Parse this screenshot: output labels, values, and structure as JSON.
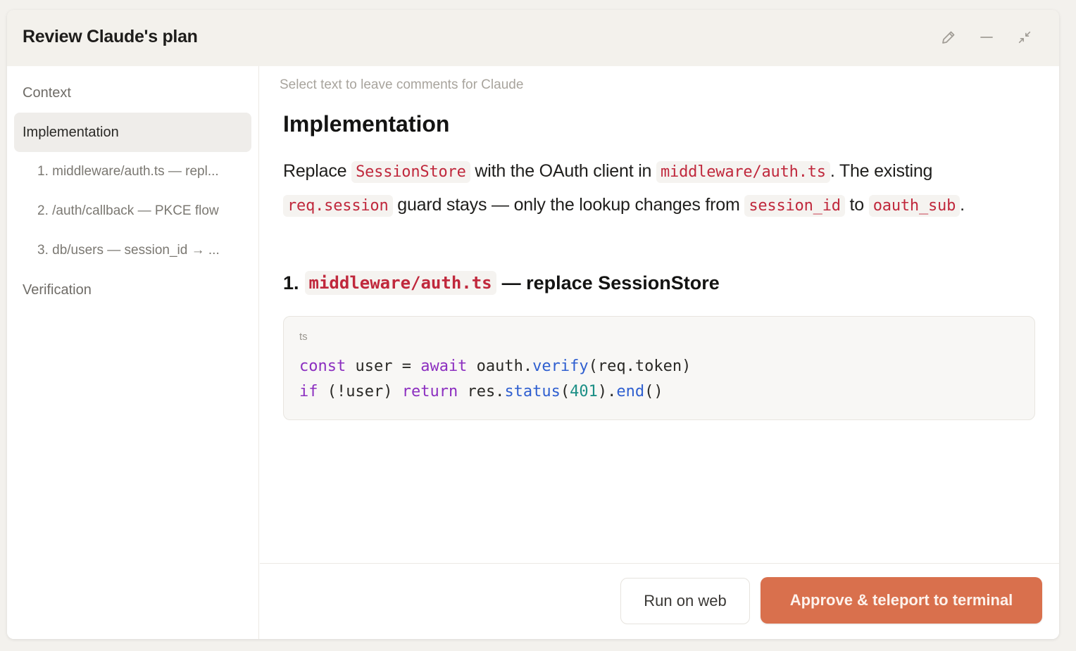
{
  "window": {
    "title": "Review Claude's plan",
    "controls": {
      "edit_icon": "pencil-icon",
      "minimize_icon": "minimize-icon",
      "collapse_icon": "collapse-icon"
    }
  },
  "sidebar": {
    "items": [
      {
        "label": "Context",
        "active": false
      },
      {
        "label": "Implementation",
        "active": true
      },
      {
        "label": "1. middleware/auth.ts — repl...",
        "sub": true
      },
      {
        "label": "2. /auth/callback — PKCE flow",
        "sub": true
      },
      {
        "label": "3. db/users — session_id → ...",
        "sub": true
      },
      {
        "label": "Verification",
        "active": false
      }
    ]
  },
  "main": {
    "hint": "Select text to leave comments for Claude",
    "heading": "Implementation",
    "paragraph": {
      "t1": "Replace",
      "c1": "SessionStore",
      "t2": "with the OAuth client in",
      "c2": "middleware/auth.ts",
      "t3": ". The existing",
      "c3": "req.session",
      "t4": "guard stays — only the lookup changes from",
      "c4": "session_id",
      "t5": "to",
      "c5": "oauth_sub",
      "t6": "."
    },
    "step": {
      "number": "1.",
      "code": "middleware/auth.ts",
      "text": "— replace SessionStore"
    },
    "codeblock": {
      "lang": "ts",
      "line1": {
        "a": "const",
        "b": " user = ",
        "c": "await",
        "d": " oauth.",
        "e": "verify",
        "f": "(req.token)"
      },
      "line2": {
        "a": "if",
        "b": " (!user) ",
        "c": "return",
        "d": " res.",
        "e": "status",
        "f": "(",
        "g": "401",
        "h": ").",
        "i": "end",
        "j": "()"
      }
    }
  },
  "footer": {
    "secondary_label": "Run on web",
    "primary_label": "Approve & teleport to terminal"
  },
  "colors": {
    "accent": "#d9704d",
    "inline_code": "#c0283c",
    "keyword": "#8c2fc0",
    "function": "#2f5fd0",
    "number": "#1c8f86"
  }
}
